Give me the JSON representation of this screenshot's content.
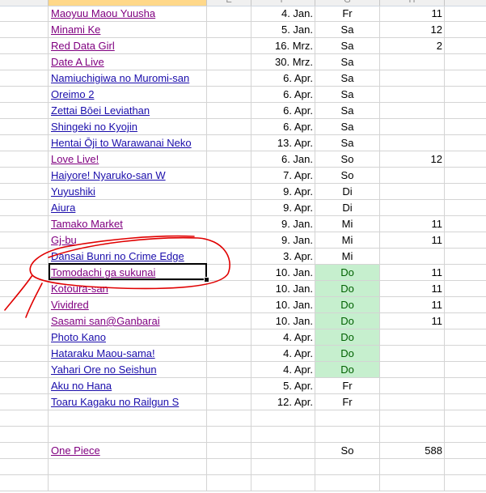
{
  "rows": [
    {
      "title": "Maoyuu Maou Yuusha",
      "date": "4. Jan.",
      "day": "Fr",
      "num": "11",
      "visited": true,
      "green": false
    },
    {
      "title": "Minami Ke",
      "date": "5. Jan.",
      "day": "Sa",
      "num": "12",
      "visited": true,
      "green": false
    },
    {
      "title": "Red Data Girl",
      "date": "16. Mrz.",
      "day": "Sa",
      "num": "2",
      "visited": true,
      "green": false
    },
    {
      "title": "Date A Live",
      "date": "30. Mrz.",
      "day": "Sa",
      "num": "",
      "visited": true,
      "green": false
    },
    {
      "title": "Namiuchigiwa no Muromi-san",
      "date": "6. Apr.",
      "day": "Sa",
      "num": "",
      "visited": false,
      "green": false
    },
    {
      "title": "Oreimo 2",
      "date": "6. Apr.",
      "day": "Sa",
      "num": "",
      "visited": false,
      "green": false
    },
    {
      "title": "Zettai Bōei Leviathan",
      "date": "6. Apr.",
      "day": "Sa",
      "num": "",
      "visited": false,
      "green": false
    },
    {
      "title": "Shingeki no Kyojin",
      "date": "6. Apr.",
      "day": "Sa",
      "num": "",
      "visited": false,
      "green": false
    },
    {
      "title": "Hentai Ōji to Warawanai Neko",
      "date": "13. Apr.",
      "day": "Sa",
      "num": "",
      "visited": false,
      "green": false
    },
    {
      "title": "Love Live!",
      "date": "6. Jan.",
      "day": "So",
      "num": "12",
      "visited": true,
      "green": false
    },
    {
      "title": "Haiyore! Nyaruko-san W",
      "date": "7. Apr.",
      "day": "So",
      "num": "",
      "visited": false,
      "green": false
    },
    {
      "title": "Yuyushiki",
      "date": "9. Apr.",
      "day": "Di",
      "num": "",
      "visited": false,
      "green": false
    },
    {
      "title": "Aiura",
      "date": "9. Apr.",
      "day": "Di",
      "num": "",
      "visited": false,
      "green": false
    },
    {
      "title": "Tamako Market",
      "date": "9. Jan.",
      "day": "Mi",
      "num": "11",
      "visited": true,
      "green": false
    },
    {
      "title": "Gj-bu",
      "date": "9. Jan.",
      "day": "Mi",
      "num": "11",
      "visited": true,
      "green": false
    },
    {
      "title": "Dansai Bunri no Crime Edge",
      "date": "3. Apr.",
      "day": "Mi",
      "num": "",
      "visited": false,
      "green": false
    },
    {
      "title": "Tomodachi ga sukunai",
      "date": "10. Jan.",
      "day": "Do",
      "num": "11",
      "visited": true,
      "green": true
    },
    {
      "title": "Kotoura-san",
      "date": "10. Jan.",
      "day": "Do",
      "num": "11",
      "visited": true,
      "green": true
    },
    {
      "title": "Vividred",
      "date": "10. Jan.",
      "day": "Do",
      "num": "11",
      "visited": true,
      "green": true
    },
    {
      "title": "Sasami san@Ganbarai",
      "date": "10. Jan.",
      "day": "Do",
      "num": "11",
      "visited": true,
      "green": true
    },
    {
      "title": "Photo Kano",
      "date": "4. Apr.",
      "day": "Do",
      "num": "",
      "visited": false,
      "green": true
    },
    {
      "title": "Hataraku Maou-sama!",
      "date": "4. Apr.",
      "day": "Do",
      "num": "",
      "visited": false,
      "green": true
    },
    {
      "title": "Yahari Ore no Seishun",
      "date": "4. Apr.",
      "day": "Do",
      "num": "",
      "visited": false,
      "green": true
    },
    {
      "title": "Aku no Hana",
      "date": "5. Apr.",
      "day": "Fr",
      "num": "",
      "visited": false,
      "green": false
    },
    {
      "title": "Toaru Kagaku no Railgun S",
      "date": "12. Apr.",
      "day": "Fr",
      "num": "",
      "visited": false,
      "green": false
    },
    {
      "title": "",
      "date": "",
      "day": "",
      "num": "",
      "visited": false,
      "green": false
    },
    {
      "title": "",
      "date": "",
      "day": "",
      "num": "",
      "visited": false,
      "green": false
    },
    {
      "title": "One Piece",
      "date": "",
      "day": "So",
      "num": "588",
      "visited": true,
      "green": false
    },
    {
      "title": "",
      "date": "",
      "day": "",
      "num": "",
      "visited": false,
      "green": false
    },
    {
      "title": "",
      "date": "",
      "day": "",
      "num": "",
      "visited": false,
      "green": false
    }
  ],
  "header_letters": [
    "",
    "",
    "E",
    "F",
    "G",
    "H",
    ""
  ],
  "colors": {
    "visited_link": "#800080",
    "link": "#1a0dab",
    "green_fill": "#c6efce",
    "green_text": "#006100",
    "annotation": "#e00000"
  }
}
